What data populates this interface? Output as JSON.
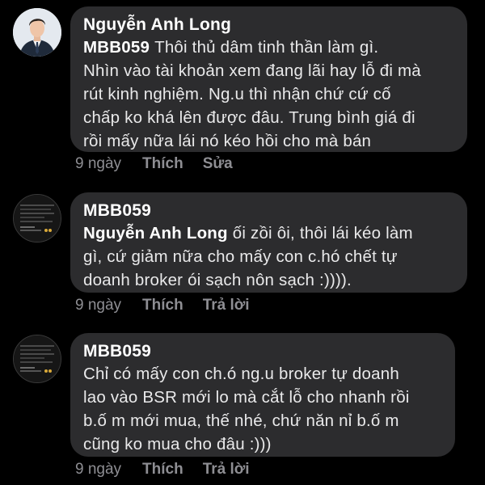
{
  "comments": [
    {
      "author": "Nguyễn Anh Long",
      "mention": "MBB059",
      "lines": [
        "Thôi thủ dâm tinh thần làm gì.",
        "Nhìn vào tài khoản xem đang lãi hay lỗ đi mà",
        "rút kinh nghiệm. Ng.u thì nhận chứ cứ cố",
        "chấp ko khá lên được đâu. Trung bình giá đi",
        "rồi mấy nữa lái nó kéo hồi cho mà bán"
      ],
      "time": "9 ngày",
      "like_label": "Thích",
      "second_action": "Sửa"
    },
    {
      "author": "MBB059",
      "mention": "Nguyễn Anh Long",
      "lines": [
        "ối zồi ôi, thôi lái kéo làm",
        "gì, cứ giảm nữa cho mấy con c.hó chết tự",
        "doanh broker ói sạch nôn sạch :))))."
      ],
      "time": "9 ngày",
      "like_label": "Thích",
      "second_action": "Trả lời"
    },
    {
      "author": "MBB059",
      "lines": [
        "Chỉ có mấy con ch.ó ng.u broker tự doanh",
        "lao vào BSR mới lo mà cắt lỗ cho nhanh rồi",
        "b.ố m mới mua, thế nhé, chứ năn nỉ b.ố m",
        "cũng ko mua cho đâu :)))"
      ],
      "time": "9 ngày",
      "like_label": "Thích",
      "second_action": "Trả lời"
    }
  ],
  "colors": {
    "background": "#000000",
    "bubble": "#2c2c2e",
    "text": "#e9e9ea",
    "muted": "#8e8e93"
  },
  "icons": {
    "avatar_1": "profile-photo-person-in-suit",
    "avatar_2": "profile-photo-screenshot-thumbnail",
    "avatar_3": "profile-photo-screenshot-thumbnail"
  }
}
